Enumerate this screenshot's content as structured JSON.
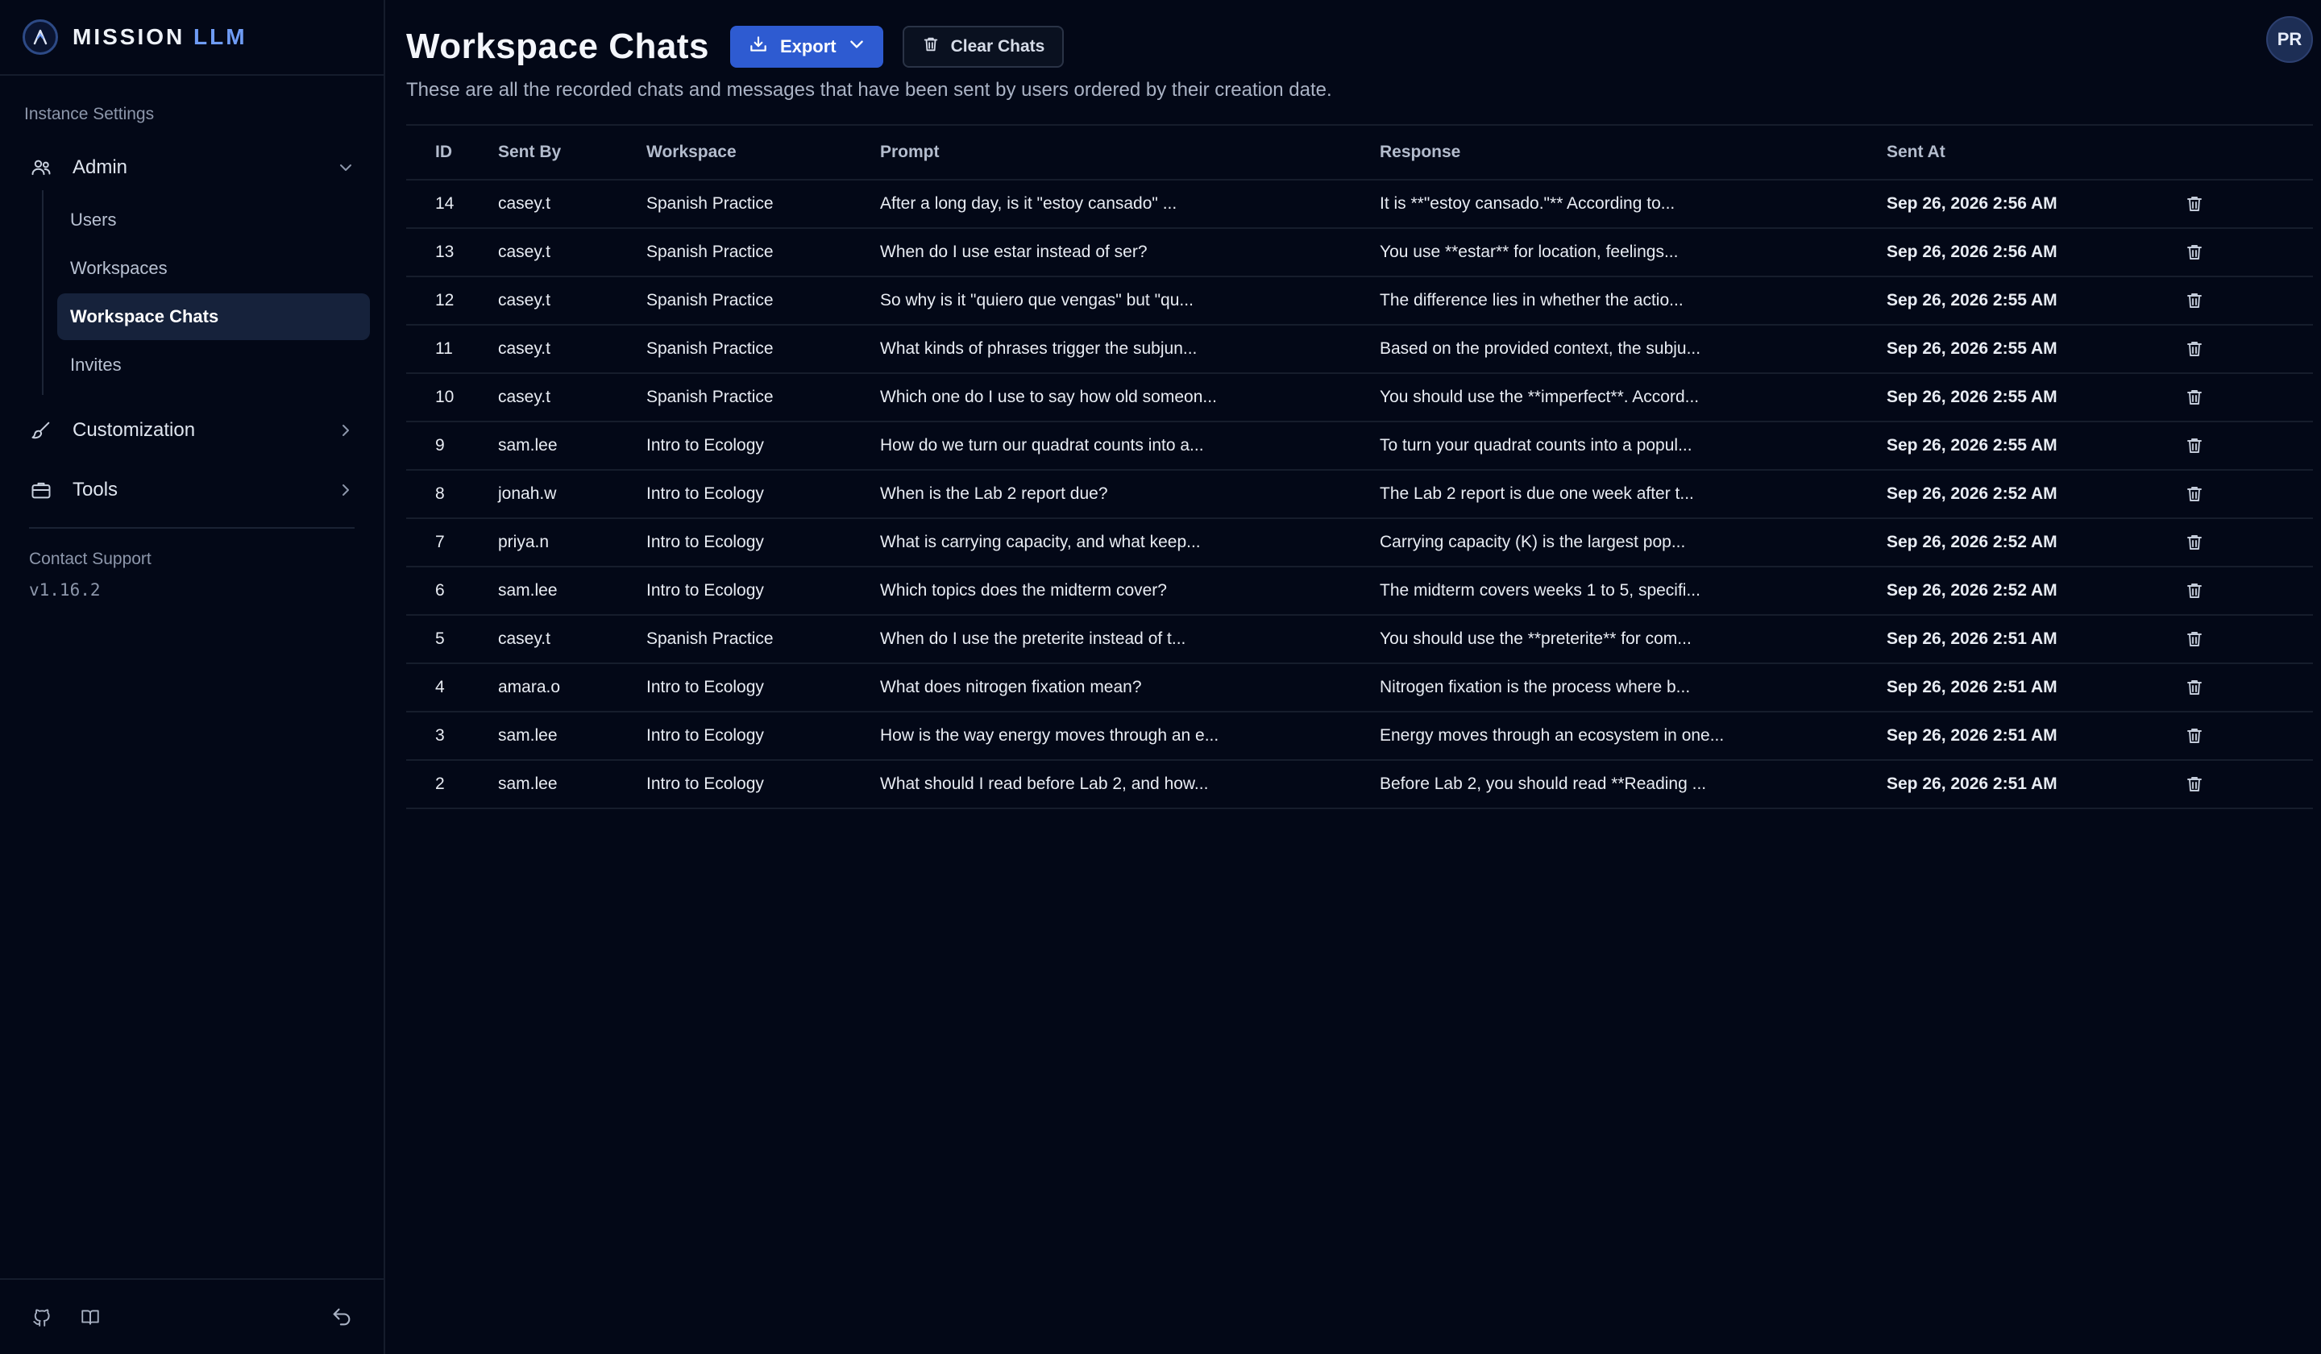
{
  "brand": {
    "name_main": "MISSION",
    "name_accent": "LLM"
  },
  "sidebar": {
    "section_label": "Instance Settings",
    "admin": {
      "label": "Admin",
      "items": [
        {
          "label": "Users"
        },
        {
          "label": "Workspaces"
        },
        {
          "label": "Workspace Chats",
          "active": true
        },
        {
          "label": "Invites"
        }
      ]
    },
    "customization": {
      "label": "Customization"
    },
    "tools": {
      "label": "Tools"
    },
    "support_label": "Contact Support",
    "version": "v1.16.2"
  },
  "header": {
    "title": "Workspace Chats",
    "export_label": "Export",
    "clear_label": "Clear Chats",
    "subtitle": "These are all the recorded chats and messages that have been sent by users ordered by their creation date.",
    "avatar_initials": "PR"
  },
  "table": {
    "headers": {
      "id": "ID",
      "sent_by": "Sent By",
      "workspace": "Workspace",
      "prompt": "Prompt",
      "response": "Response",
      "sent_at": "Sent At"
    },
    "rows": [
      {
        "id": "14",
        "sent_by": "casey.t",
        "workspace": "Spanish Practice",
        "prompt": "After a long day, is it \"estoy cansado\" ...",
        "response": "It is **\"estoy cansado.\"** According to...",
        "sent_at": "Sep 26, 2026 2:56 AM"
      },
      {
        "id": "13",
        "sent_by": "casey.t",
        "workspace": "Spanish Practice",
        "prompt": "When do I use estar instead of ser?",
        "response": "You use **estar** for location, feelings...",
        "sent_at": "Sep 26, 2026 2:56 AM"
      },
      {
        "id": "12",
        "sent_by": "casey.t",
        "workspace": "Spanish Practice",
        "prompt": "So why is it \"quiero que vengas\" but \"qu...",
        "response": "The difference lies in whether the actio...",
        "sent_at": "Sep 26, 2026 2:55 AM"
      },
      {
        "id": "11",
        "sent_by": "casey.t",
        "workspace": "Spanish Practice",
        "prompt": "What kinds of phrases trigger the subjun...",
        "response": "Based on the provided context, the subju...",
        "sent_at": "Sep 26, 2026 2:55 AM"
      },
      {
        "id": "10",
        "sent_by": "casey.t",
        "workspace": "Spanish Practice",
        "prompt": "Which one do I use to say how old someon...",
        "response": "You should use the **imperfect**. Accord...",
        "sent_at": "Sep 26, 2026 2:55 AM"
      },
      {
        "id": "9",
        "sent_by": "sam.lee",
        "workspace": "Intro to Ecology",
        "prompt": "How do we turn our quadrat counts into a...",
        "response": "To turn your quadrat counts into a popul...",
        "sent_at": "Sep 26, 2026 2:55 AM"
      },
      {
        "id": "8",
        "sent_by": "jonah.w",
        "workspace": "Intro to Ecology",
        "prompt": "When is the Lab 2 report due?",
        "response": "The Lab 2 report is due one week after t...",
        "sent_at": "Sep 26, 2026 2:52 AM"
      },
      {
        "id": "7",
        "sent_by": "priya.n",
        "workspace": "Intro to Ecology",
        "prompt": "What is carrying capacity, and what keep...",
        "response": "Carrying capacity (K) is the largest pop...",
        "sent_at": "Sep 26, 2026 2:52 AM"
      },
      {
        "id": "6",
        "sent_by": "sam.lee",
        "workspace": "Intro to Ecology",
        "prompt": "Which topics does the midterm cover?",
        "response": "The midterm covers weeks 1 to 5, specifi...",
        "sent_at": "Sep 26, 2026 2:52 AM"
      },
      {
        "id": "5",
        "sent_by": "casey.t",
        "workspace": "Spanish Practice",
        "prompt": "When do I use the preterite instead of t...",
        "response": "You should use the **preterite** for com...",
        "sent_at": "Sep 26, 2026 2:51 AM"
      },
      {
        "id": "4",
        "sent_by": "amara.o",
        "workspace": "Intro to Ecology",
        "prompt": "What does nitrogen fixation mean?",
        "response": "Nitrogen fixation is the process where b...",
        "sent_at": "Sep 26, 2026 2:51 AM"
      },
      {
        "id": "3",
        "sent_by": "sam.lee",
        "workspace": "Intro to Ecology",
        "prompt": "How is the way energy moves through an e...",
        "response": "Energy moves through an ecosystem in one...",
        "sent_at": "Sep 26, 2026 2:51 AM"
      },
      {
        "id": "2",
        "sent_by": "sam.lee",
        "workspace": "Intro to Ecology",
        "prompt": "What should I read before Lab 2, and how...",
        "response": "Before Lab 2, you should read **Reading ...",
        "sent_at": "Sep 26, 2026 2:51 AM"
      }
    ]
  },
  "icons": {
    "logo": "mission-logo-icon",
    "admin": "users-icon",
    "customization": "brush-icon",
    "tools": "briefcase-icon",
    "export": "download-icon",
    "clear": "trash-icon",
    "row_action": "trash-icon",
    "footer": [
      "github-icon",
      "book-icon",
      "back-arrow-icon"
    ]
  },
  "colors": {
    "background": "#030817",
    "accent": "#2e5bd1",
    "active_nav": "#16223b",
    "brand_accent": "#6f9cf5"
  }
}
